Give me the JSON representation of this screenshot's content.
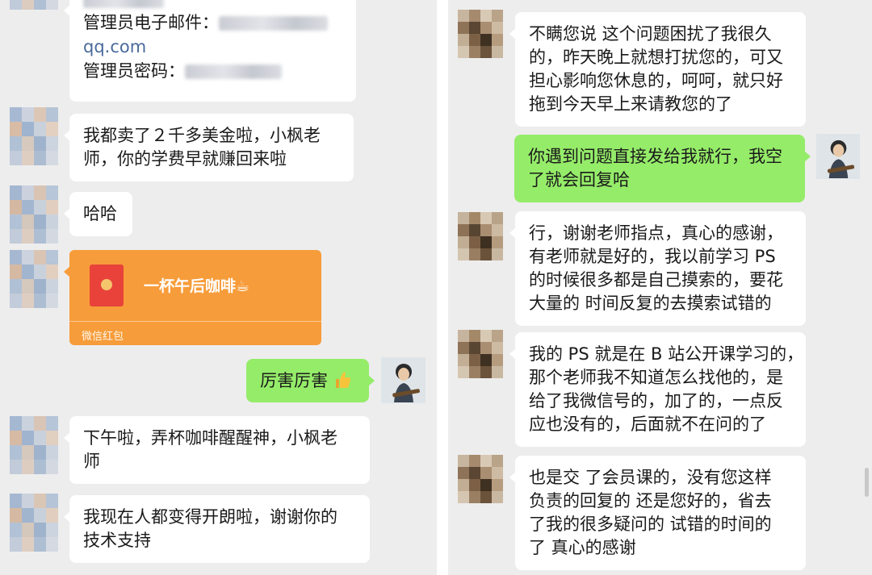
{
  "left": {
    "admin": {
      "email_label": "管理员电子邮件：",
      "email_domain": "qq.com",
      "password_label": "管理员密码："
    },
    "msg_earned": [
      "我都卖了２千多美金啦，小枫老",
      "师，你的学费早就赚回来啦"
    ],
    "msg_haha": "哈哈",
    "red_packet": {
      "title": "一杯午后咖啡☕",
      "footer": "微信红包"
    },
    "msg_reply_praise": "厉害厉害",
    "msg_coffee": [
      "下午啦，弄杯咖啡醒醒神，小枫老",
      "师"
    ],
    "msg_cheerful": [
      "我现在人都变得开朗啦，谢谢你的",
      "技术支持"
    ]
  },
  "right": {
    "msg_sorry": [
      "不瞒您说 这个问题困扰了我很久",
      "的，昨天晚上就想打扰您的，可又",
      "担心影响您休息的，呵呵，就只好",
      "拖到今天早上来请教您的了"
    ],
    "msg_reply_send": [
      "你遇到问题直接发给我就行，我空",
      "了就会回复哈"
    ],
    "msg_thanks": [
      "行，谢谢老师指点，真心的感谢，",
      "有老师就是好的，我以前学习 PS",
      "的时候很多都是自己摸索的，要花",
      "大量的 时间反复的去摸索试错的"
    ],
    "msg_bilibili": [
      "我的 PS 就是在 B 站公开课学习的，",
      "那个老师我不知道怎么找他的，是",
      "给了我微信号的，加了的，一点反",
      "应也没有的，后面就不在问的了"
    ],
    "msg_member": [
      "也是交 了会员课的，没有您这样",
      "负责的回复的 还是您好的，省去",
      "了我的很多疑问的 试错的时间的",
      "了 真心的感谢"
    ]
  },
  "colors": {
    "background": "#ededed",
    "incoming_bubble": "#ffffff",
    "outgoing_bubble": "#95ec69",
    "red_packet": "#f79c3a",
    "link": "#4a6a9c"
  },
  "icons": [
    "red-packet-icon",
    "thumbs-up-icon",
    "coffee-icon"
  ]
}
